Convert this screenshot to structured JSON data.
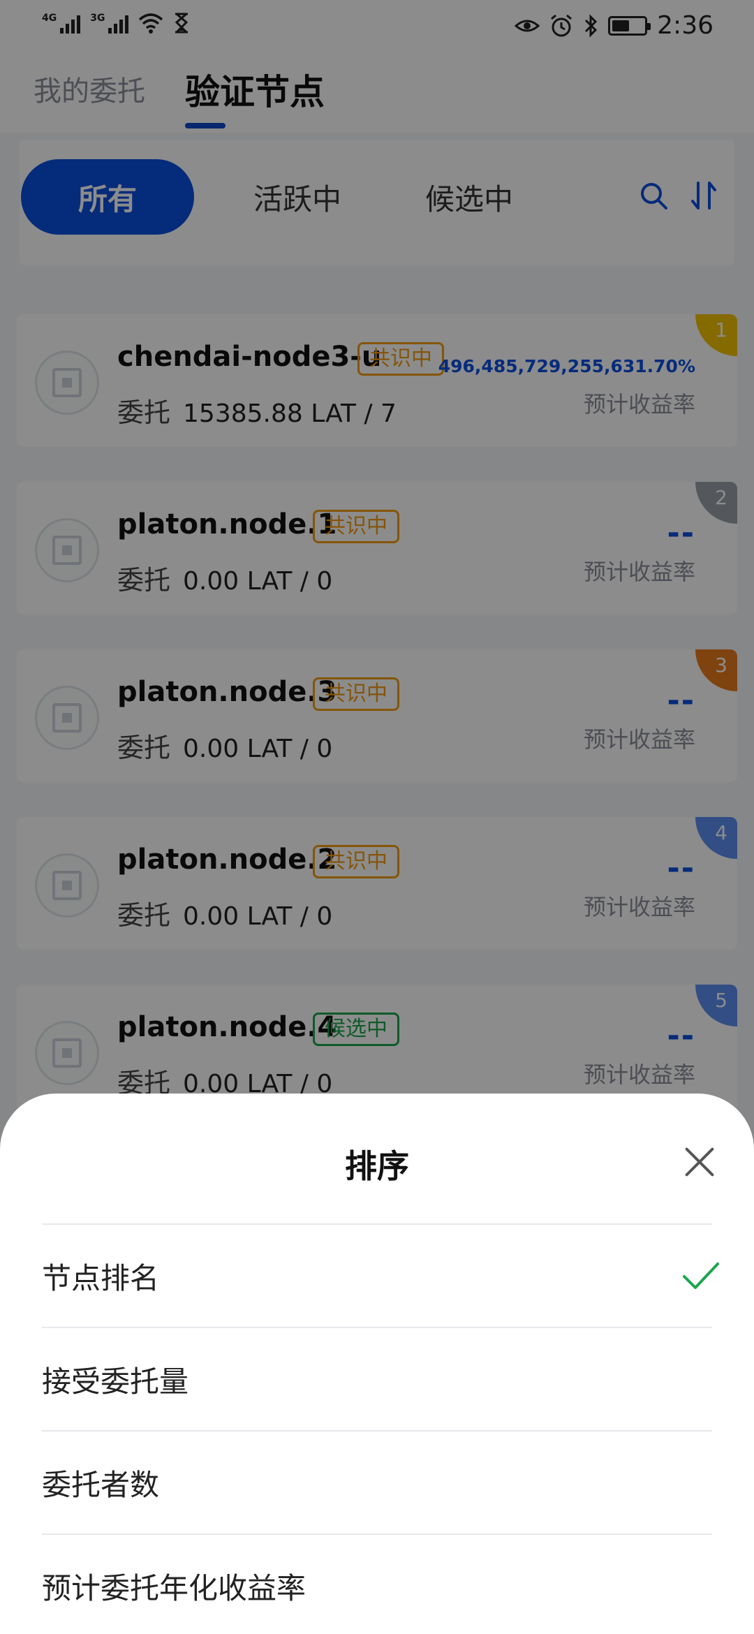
{
  "status_bar": {
    "signal1_label": "4G",
    "signal2_label": "3G",
    "time": "2:36",
    "icons": [
      "signal-4g-icon",
      "signal-3g-icon",
      "wifi-icon",
      "hourglass-icon",
      "eye-icon",
      "alarm-icon",
      "bluetooth-icon",
      "battery-icon"
    ],
    "battery_level": 0.55
  },
  "header": {
    "tabs": [
      {
        "label": "我的委托",
        "active": false
      },
      {
        "label": "验证节点",
        "active": true
      }
    ]
  },
  "filter": {
    "pills": [
      {
        "label": "所有",
        "active": true
      },
      {
        "label": "活跃中",
        "active": false
      },
      {
        "label": "候选中",
        "active": false
      }
    ],
    "icons": [
      "search-icon",
      "sort-icon"
    ]
  },
  "nodes": [
    {
      "name": "chendai-node3-u",
      "status": "共识中",
      "delegation_label": "委托",
      "delegation": "15385.88 LAT / 7",
      "rate": "496,485,729,255,631.70%",
      "rate_label": "预计收益率",
      "rank": "1",
      "rank_color": "#f2c200"
    },
    {
      "name": "platon.node.1",
      "status": "共识中",
      "delegation_label": "委托",
      "delegation": "0.00 LAT / 0",
      "rate": "--",
      "rate_label": "预计收益率",
      "rank": "2",
      "rank_color": "#9aa0a8"
    },
    {
      "name": "platon.node.3",
      "status": "共识中",
      "delegation_label": "委托",
      "delegation": "0.00 LAT / 0",
      "rate": "--",
      "rate_label": "预计收益率",
      "rank": "3",
      "rank_color": "#e87b1c"
    },
    {
      "name": "platon.node.2",
      "status": "共识中",
      "delegation_label": "委托",
      "delegation": "0.00 LAT / 0",
      "rate": "--",
      "rate_label": "预计收益率",
      "rank": "4",
      "rank_color": "#5b8ff0"
    },
    {
      "name": "platon.node.4",
      "status": "候选中",
      "delegation_label": "委托",
      "delegation": "0.00 LAT / 0",
      "rate": "--",
      "rate_label": "预计收益率",
      "rank": "5",
      "rank_color": "#5b8ff0"
    }
  ],
  "sort_sheet": {
    "title": "排序",
    "options": [
      {
        "label": "节点排名",
        "selected": true
      },
      {
        "label": "接受委托量",
        "selected": false
      },
      {
        "label": "委托者数",
        "selected": false
      },
      {
        "label": "预计委托年化收益率",
        "selected": false
      }
    ],
    "check_color": "#1aa64b"
  },
  "colors": {
    "accent": "#0a4fe0",
    "consensus_badge": "#f39c12",
    "candidate_badge": "#1aa64b"
  }
}
